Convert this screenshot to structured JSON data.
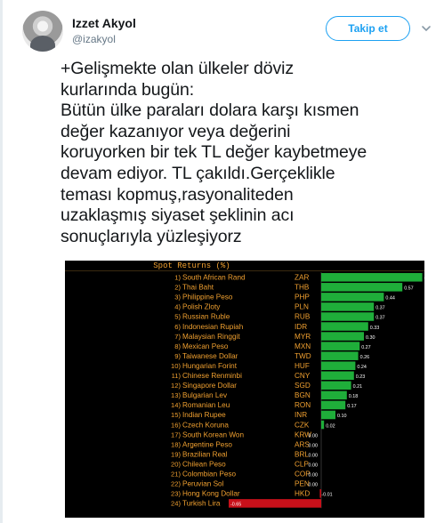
{
  "header": {
    "display_name": "Izzet Akyol",
    "handle": "@izakyol",
    "follow_label": "Takip et"
  },
  "tweet": {
    "text": "+Gelişmekte olan ülkeler döviz\nkurlarında bugün:\nBütün ülke paraları dolara karşı kısmen\ndeğer kazanıyor veya değerini\nkoruyorken bir tek TL değer kaybetmeye\ndevam ediyor. TL çakıldı.Gerçeklikle\nteması kopmuş,rasyonaliteden\nuzaklaşmış siyaset şeklinin acı\nsonuçlarıyla yüzleşiyorz"
  },
  "colors": {
    "accent": "#1da1f2",
    "chart_text": "#f0a030",
    "positive_bar": "#1fae3a",
    "negative_bar": "#c8101a"
  },
  "chart_data": {
    "type": "bar",
    "title": "Spot Returns (%)",
    "rows": [
      {
        "rank": "1)",
        "name": "South African Rand",
        "code": "ZAR",
        "value": 0.71
      },
      {
        "rank": "2)",
        "name": "Thai Baht",
        "code": "THB",
        "value": 0.57
      },
      {
        "rank": "3)",
        "name": "Philippine Peso",
        "code": "PHP",
        "value": 0.44
      },
      {
        "rank": "4)",
        "name": "Polish Zloty",
        "code": "PLN",
        "value": 0.37
      },
      {
        "rank": "5)",
        "name": "Russian Ruble",
        "code": "RUB",
        "value": 0.37
      },
      {
        "rank": "6)",
        "name": "Indonesian Rupiah",
        "code": "IDR",
        "value": 0.33
      },
      {
        "rank": "7)",
        "name": "Malaysian Ringgit",
        "code": "MYR",
        "value": 0.3
      },
      {
        "rank": "8)",
        "name": "Mexican Peso",
        "code": "MXN",
        "value": 0.27
      },
      {
        "rank": "9)",
        "name": "Taiwanese Dollar",
        "code": "TWD",
        "value": 0.26
      },
      {
        "rank": "10)",
        "name": "Hungarian Forint",
        "code": "HUF",
        "value": 0.24
      },
      {
        "rank": "11)",
        "name": "Chinese Renminbi",
        "code": "CNY",
        "value": 0.23
      },
      {
        "rank": "12)",
        "name": "Singapore Dollar",
        "code": "SGD",
        "value": 0.21
      },
      {
        "rank": "13)",
        "name": "Bulgarian Lev",
        "code": "BGN",
        "value": 0.18
      },
      {
        "rank": "14)",
        "name": "Romanian Leu",
        "code": "RON",
        "value": 0.17
      },
      {
        "rank": "15)",
        "name": "Indian Rupee",
        "code": "INR",
        "value": 0.1
      },
      {
        "rank": "16)",
        "name": "Czech Koruna",
        "code": "CZK",
        "value": 0.02
      },
      {
        "rank": "17)",
        "name": "South Korean Won",
        "code": "KRW",
        "value": 0.0
      },
      {
        "rank": "18)",
        "name": "Argentine Peso",
        "code": "ARS",
        "value": 0.0
      },
      {
        "rank": "19)",
        "name": "Brazilian Real",
        "code": "BRL",
        "value": 0.0
      },
      {
        "rank": "20)",
        "name": "Chilean Peso",
        "code": "CLP",
        "value": 0.0
      },
      {
        "rank": "21)",
        "name": "Colombian Peso",
        "code": "COP",
        "value": 0.0
      },
      {
        "rank": "22)",
        "name": "Peruvian Sol",
        "code": "PEN",
        "value": 0.0
      },
      {
        "rank": "23)",
        "name": "Hong Kong Dollar",
        "code": "HKD",
        "value": -0.01
      },
      {
        "rank": "24)",
        "name": "Turkish Lira",
        "code": "TRY",
        "value": -0.65
      }
    ],
    "value_labels": [
      "0.71",
      "0.57",
      "0.44",
      "0.37",
      "0.37",
      "0.33",
      "0.30",
      "0.27",
      "0.26",
      "0.24",
      "0.23",
      "0.21",
      "0.18",
      "0.17",
      "0.10",
      "0.02",
      "0.00",
      "0.00",
      "0.00",
      "0.00",
      "0.00",
      "0.00",
      "-0.01",
      "-0.65"
    ]
  }
}
